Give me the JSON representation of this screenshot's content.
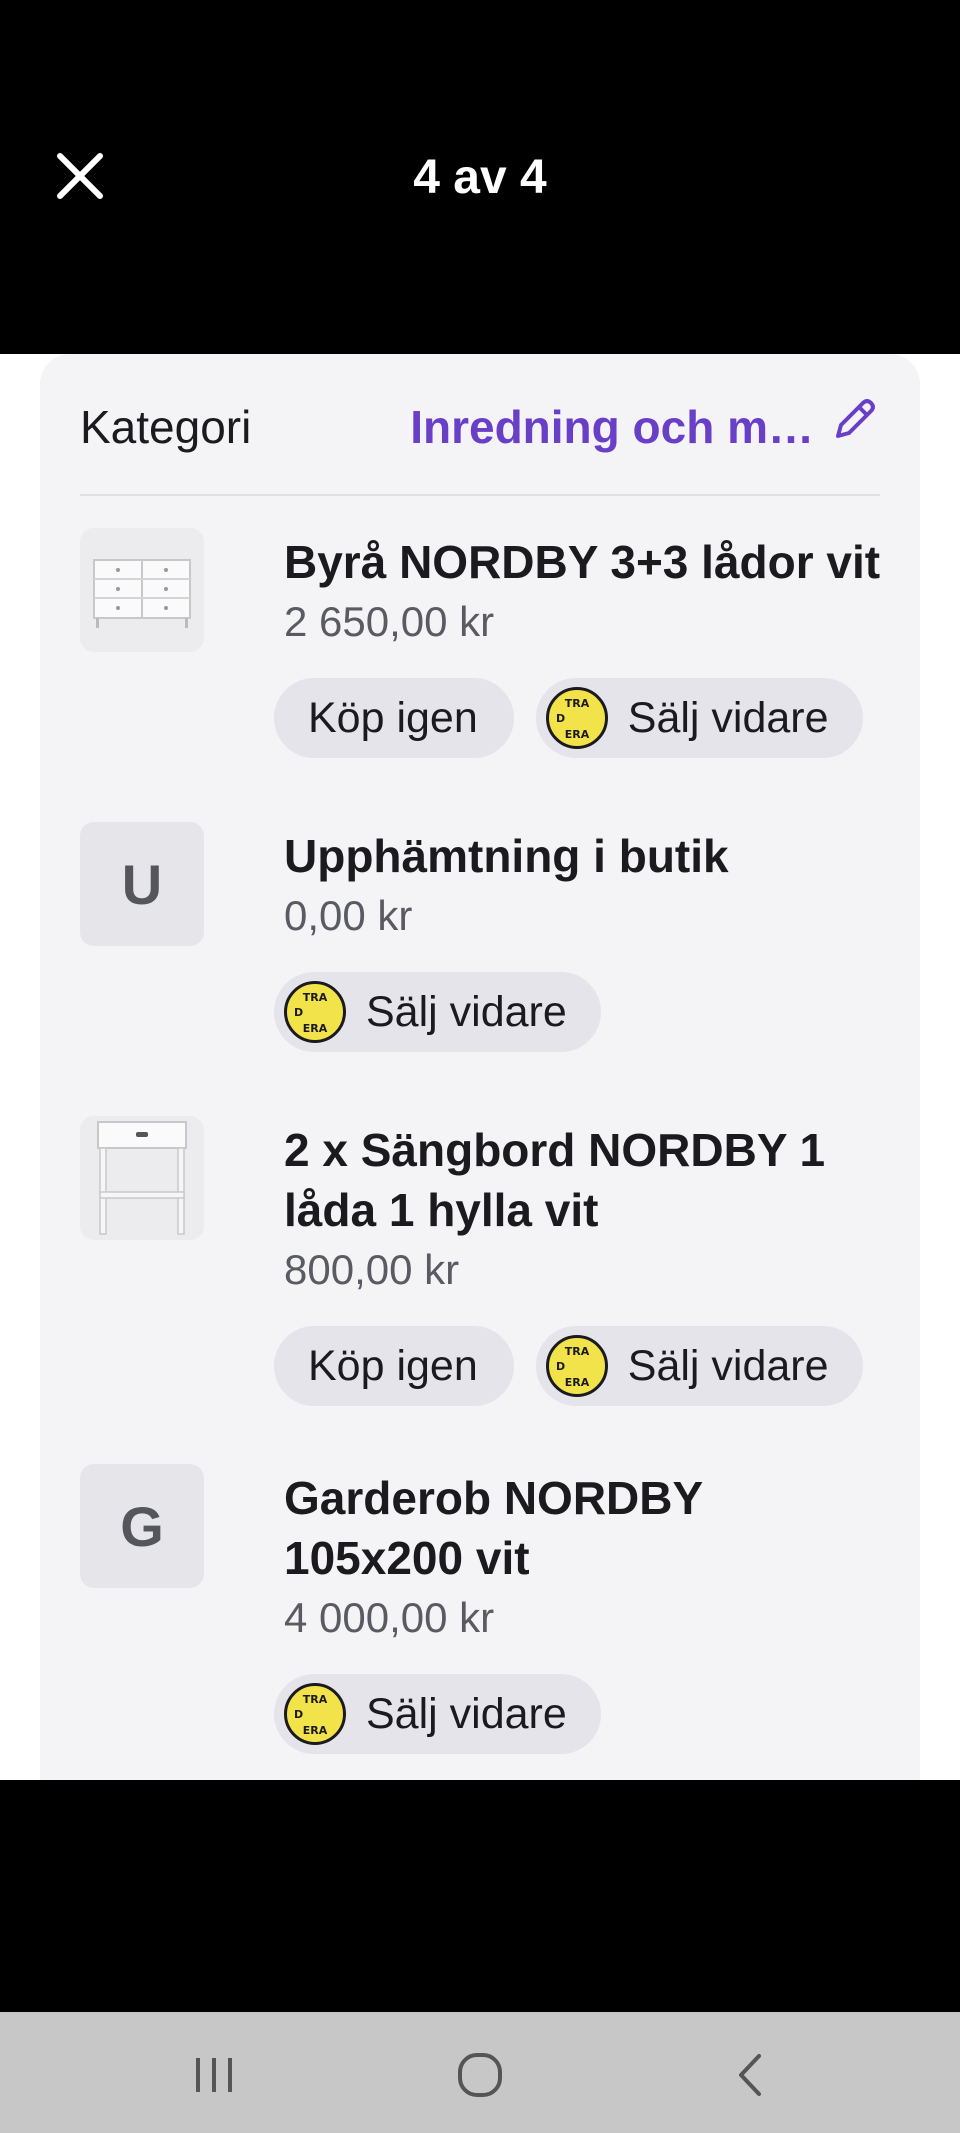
{
  "header": {
    "counter": "4 av 4"
  },
  "category": {
    "label": "Kategori",
    "value": "Inredning och m…"
  },
  "items": [
    {
      "title": "Byrå NORDBY 3+3 lådor vit",
      "price": "2 650,00 kr",
      "buy_again": "Köp igen",
      "sell_on": "Sälj vidare"
    },
    {
      "letter": "U",
      "title": "Upphämtning i butik",
      "price": "0,00 kr",
      "sell_on": "Sälj vidare"
    },
    {
      "title": "2 x Sängbord NORDBY 1 låda 1 hylla vit",
      "price": "800,00 kr",
      "buy_again": "Köp igen",
      "sell_on": "Sälj vidare"
    },
    {
      "letter": "G",
      "title": "Garderob NORDBY 105x200 vit",
      "price": "4 000,00 kr",
      "sell_on": "Sälj vidare"
    }
  ],
  "colors": {
    "accent": "#6a3fc8",
    "trade_logo": "#f2e34a"
  },
  "icons": [
    "close-icon",
    "edit-pencil-icon",
    "dresser-image",
    "nightstand-image",
    "tradera-logo",
    "recents-icon",
    "home-icon",
    "back-icon"
  ]
}
